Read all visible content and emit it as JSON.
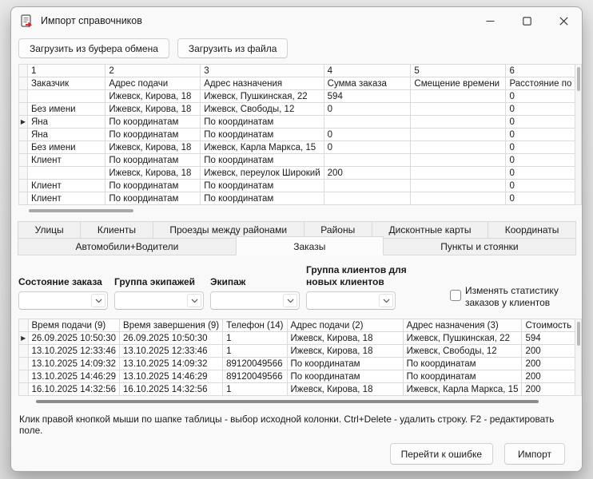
{
  "window": {
    "title": "Импорт справочников"
  },
  "toolbar": {
    "load_clipboard": "Загрузить из буфера обмена",
    "load_file": "Загрузить из файла"
  },
  "source_grid": {
    "number_headers": [
      "1",
      "2",
      "3",
      "4",
      "5",
      "6"
    ],
    "row_marker": "▶",
    "selected_row_index": 3,
    "rows": [
      [
        "Заказчик",
        "Адрес подачи",
        "Адрес назначения",
        "Сумма заказа",
        "Смещение времени",
        "Расстояние по"
      ],
      [
        "",
        "Ижевск, Кирова, 18",
        "Ижевск, Пушкинская, 22",
        "594",
        "",
        "0"
      ],
      [
        "Без имени",
        "Ижевск, Кирова, 18",
        "Ижевск, Свободы, 12",
        "0",
        "",
        "0"
      ],
      [
        "Яна",
        "По координатам",
        "По координатам",
        "",
        "",
        "0"
      ],
      [
        "Яна",
        "По координатам",
        "По координатам",
        "0",
        "",
        "0"
      ],
      [
        "Без имени",
        "Ижевск, Кирова, 18",
        "Ижевск, Карла Маркса, 15",
        "0",
        "",
        "0"
      ],
      [
        "Клиент",
        "По координатам",
        "По координатам",
        "",
        "",
        "0"
      ],
      [
        "",
        "Ижевск, Кирова, 18",
        "Ижевск, переулок Широкий",
        "200",
        "",
        "0"
      ],
      [
        "Клиент",
        "По координатам",
        "По координатам",
        "",
        "",
        "0"
      ],
      [
        "Клиент",
        "По координатам",
        "По координатам",
        "",
        "",
        "0"
      ]
    ]
  },
  "tabs": {
    "row1": [
      "Улицы",
      "Клиенты",
      "Проезды между районами",
      "Районы",
      "Дисконтные карты",
      "Координаты"
    ],
    "row2": [
      "Автомобили+Водители",
      "Заказы",
      "Пункты и стоянки"
    ],
    "active": "Заказы"
  },
  "filters": {
    "order_state_label": "Состояние заказа",
    "crew_group_label": "Группа экипажей",
    "crew_label": "Экипаж",
    "client_group_label": "Группа клиентов для новых клиентов",
    "checkbox_label": "Изменять статистику заказов у клиентов",
    "checkbox_checked": false
  },
  "orders_grid": {
    "headers": [
      "Время подачи (9)",
      "Время завершения (9)",
      "Телефон (14)",
      "Адрес подачи (2)",
      "Адрес назначения (3)",
      "Стоимость"
    ],
    "row_marker": "▶",
    "selected_row_index": 0,
    "rows": [
      [
        "26.09.2025 10:50:30",
        "26.09.2025 10:50:30",
        "1",
        "Ижевск, Кирова, 18",
        "Ижевск, Пушкинская, 22",
        "594"
      ],
      [
        "13.10.2025 12:33:46",
        "13.10.2025 12:33:46",
        "1",
        "Ижевск, Кирова, 18",
        "Ижевск, Свободы, 12",
        "200"
      ],
      [
        "13.10.2025 14:09:32",
        "13.10.2025 14:09:32",
        "89120049566",
        "По координатам",
        "По координатам",
        "200"
      ],
      [
        "13.10.2025 14:46:29",
        "13.10.2025 14:46:29",
        "89120049566",
        "По координатам",
        "По координатам",
        "200"
      ],
      [
        "16.10.2025 14:32:56",
        "16.10.2025 14:32:56",
        "1",
        "Ижевск, Кирова, 18",
        "Ижевск, Карла Маркса, 15",
        "200"
      ]
    ]
  },
  "hint": "Клик правой кнопкой мыши по шапке таблицы - выбор исходной колонки. Ctrl+Delete - удалить строку. F2 - редактировать поле.",
  "footer": {
    "goto_error": "Перейти к ошибке",
    "import": "Импорт"
  }
}
